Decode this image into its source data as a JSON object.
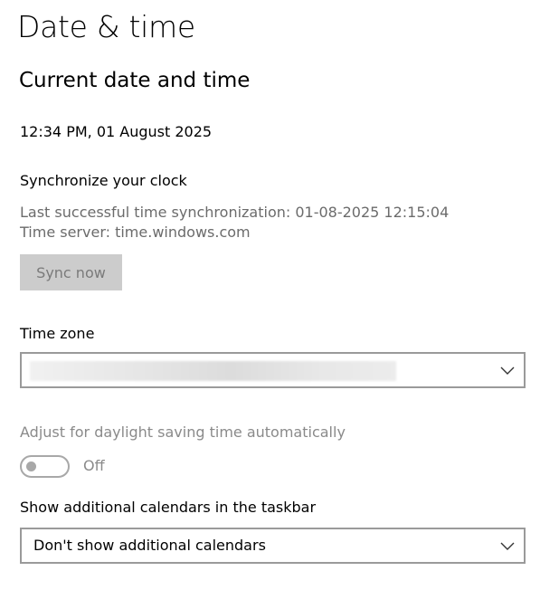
{
  "page": {
    "title": "Date & time"
  },
  "current": {
    "section_title": "Current date and time",
    "datetime": "12:34 PM, 01 August 2025"
  },
  "sync": {
    "heading": "Synchronize your clock",
    "last_sync": "Last successful time synchronization: 01-08-2025 12:15:04",
    "server": "Time server: time.windows.com",
    "button_label": "Sync now"
  },
  "timezone": {
    "label": "Time zone",
    "value_blurred": true,
    "chevron_icon": "chevron-down-icon"
  },
  "dst": {
    "label": "Adjust for daylight saving time automatically",
    "toggle_state": "Off",
    "enabled": false
  },
  "calendars": {
    "label": "Show additional calendars in the taskbar",
    "selected": "Don't show additional calendars",
    "chevron_icon": "chevron-down-icon"
  },
  "colors": {
    "disabled_text": "#8a8a8a",
    "secondary_text": "#6b6b6b",
    "button_disabled_bg": "#cccccc",
    "border": "#9a9a9a"
  }
}
